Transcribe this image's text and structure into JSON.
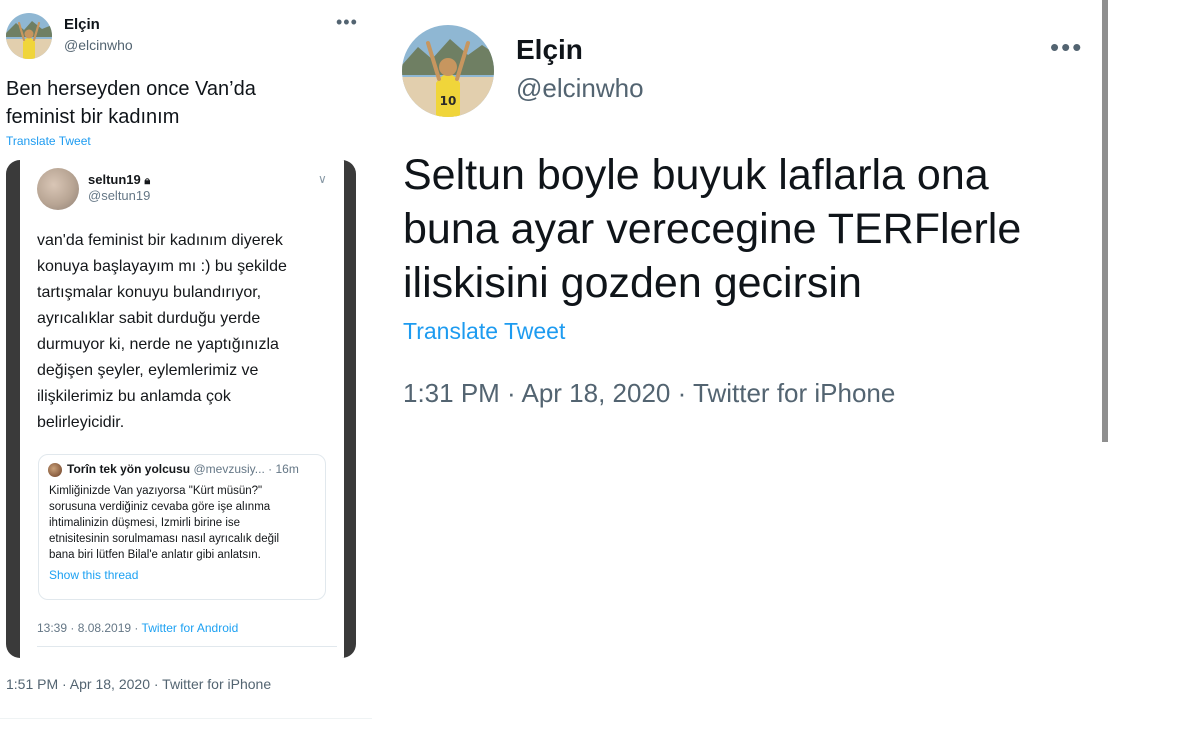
{
  "left_tweet": {
    "author_name": "Elçin",
    "author_handle": "@elcinwho",
    "more_icon": "more-horizontal-icon",
    "text_line1": "Ben herseyden once Van’da",
    "text_line2": "feminist bir kadınım",
    "translate_label": "Translate Tweet",
    "footer": "1:51 PM · Apr 18, 2020 · Twitter for iPhone",
    "embedded_screenshot": {
      "author_name": "seltun19",
      "lock_icon": "lock-icon",
      "author_handle": "@seltun19",
      "chevron_icon": "chevron-down-icon",
      "body_lines": [
        "van'da feminist bir kadınım diyerek",
        "konuya başlayayım mı :) bu şekilde",
        "tartışmalar konuyu bulandırıyor,",
        "ayrıcalıklar sabit durduğu yerde",
        "durmuyor ki, nerde ne yaptığınızla",
        "değişen şeyler, eylemlerimiz ve",
        "ilişkilerimiz bu anlamda çok",
        "belirleyicidir."
      ],
      "quote": {
        "author_name": "Torîn tek yön yolcusu",
        "author_handle": "@mevzusiy...",
        "time": "· 16m",
        "text_lines": [
          "Kimliğinizde Van yazıyorsa \"Kürt müsün?\"",
          "sorusuna verdiğiniz cevaba göre işe alınma",
          "ihtimalinizin düşmesi, Izmirli birine ise",
          "etnisitesinin sorulmaması nasıl ayrıcalık değil",
          "bana biri lütfen Bilal'e anlatır gibi anlatsın."
        ],
        "show_thread": "Show this thread"
      },
      "timestamp": "13:39 · 8.08.2019 · ",
      "via": "Twitter for Android"
    }
  },
  "right_tweet": {
    "author_name": "Elçin",
    "author_handle": "@elcinwho",
    "more_icon": "more-horizontal-icon",
    "text_line1": "Seltun boyle buyuk laflarla ona",
    "text_line2": "buna ayar verecegine TERFlerle",
    "text_line3": "iliskisini gozden gecirsin",
    "translate_label": "Translate Tweet",
    "footer": "1:31 PM · Apr 18, 2020 · Twitter for iPhone"
  },
  "colors": {
    "link_blue": "#1d9bf0",
    "secondary_text": "#536471",
    "primary_text": "#0f1419",
    "embed_frame": "#3a3a3a"
  }
}
